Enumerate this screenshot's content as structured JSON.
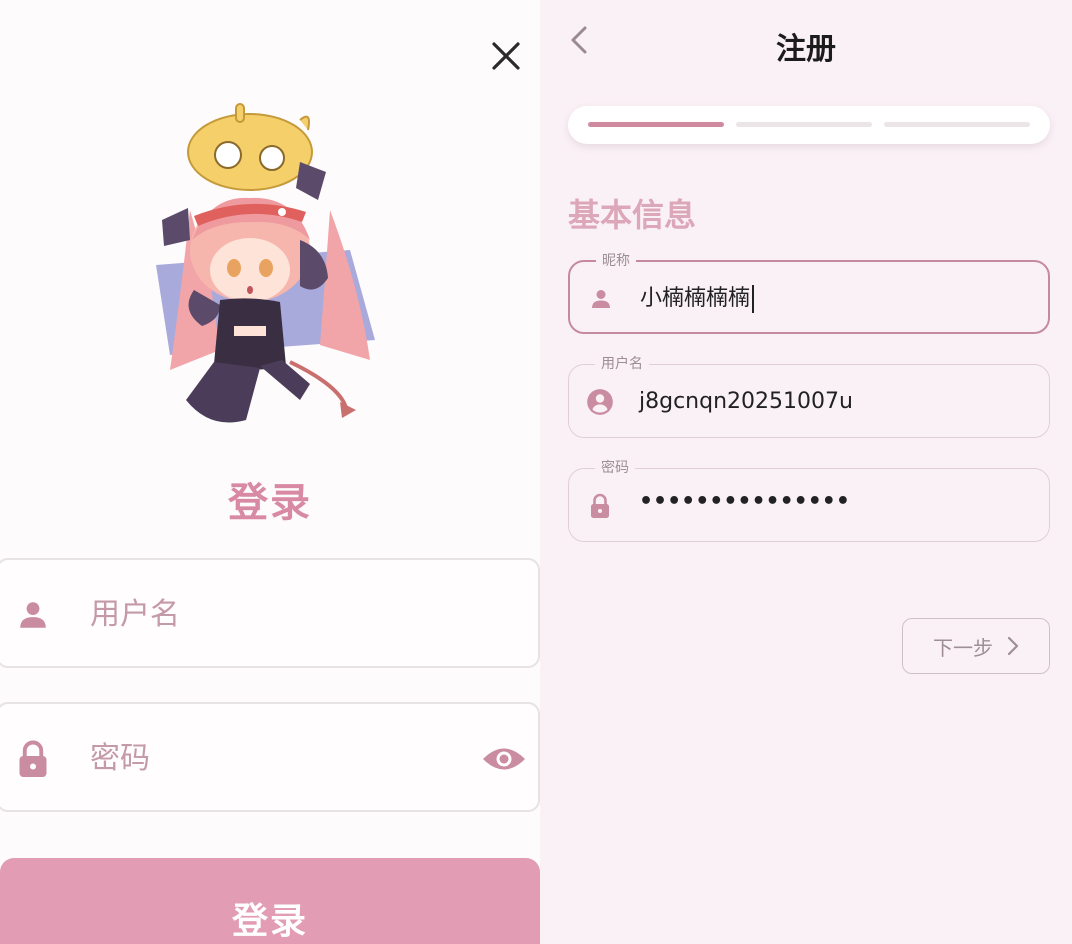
{
  "login": {
    "title": "登录",
    "username_placeholder": "用户名",
    "password_placeholder": "密码",
    "submit_label": "登录"
  },
  "register": {
    "title": "注册",
    "progress_step": 1,
    "progress_total": 3,
    "section_title": "基本信息",
    "fields": [
      {
        "label": "昵称",
        "value": "小楠楠楠楠",
        "icon": "person-icon"
      },
      {
        "label": "用户名",
        "value": "j8gcnqn20251007u",
        "icon": "account-circle-icon"
      },
      {
        "label": "密码",
        "value": "•••••••••••••••",
        "icon": "lock-icon"
      }
    ],
    "next_label": "下一步"
  },
  "colors": {
    "accent": "#d88aa4",
    "button": "#e29cb4",
    "register_bg": "#faf1f6"
  }
}
